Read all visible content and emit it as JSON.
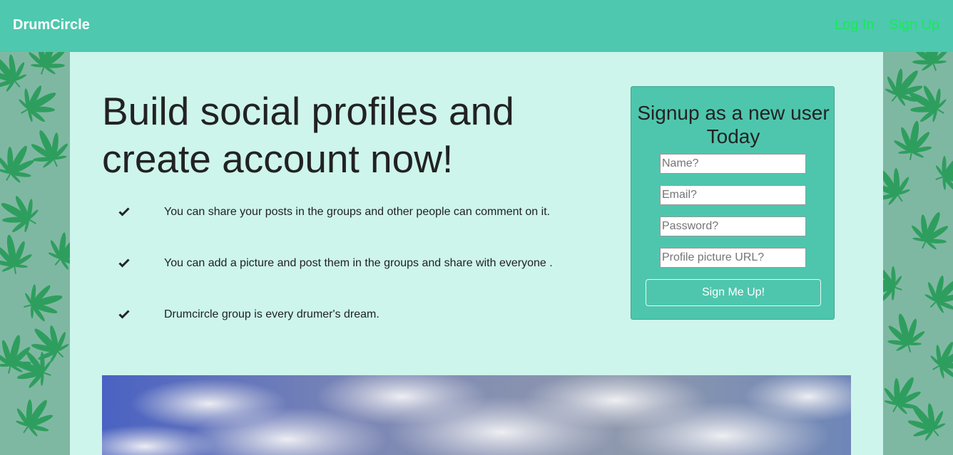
{
  "navbar": {
    "brand": "DrumCircle",
    "login_label": "Log In",
    "signup_label": "Sign Up",
    "bar_color": "#4ec8ae",
    "link_color": "#19e85c"
  },
  "hero": {
    "headline": "Build social profiles and create account now!",
    "features": [
      {
        "icon": "check-icon",
        "text": "You can share your posts in the groups and other people can comment on it."
      },
      {
        "icon": "check-icon",
        "text": "You can add a picture and post them in the groups and share with everyone ."
      },
      {
        "icon": "check-icon",
        "text": "Drumcircle group is every drumer's dream."
      }
    ]
  },
  "signup": {
    "title": "Signup as a new user Today",
    "name_placeholder": "Name?",
    "email_placeholder": "Email?",
    "password_placeholder": "Password?",
    "picture_placeholder": "Profile picture URL?",
    "button_label": "Sign Me Up!",
    "panel_color": "#4ec6ad"
  },
  "background": {
    "pattern_icon": "cannabis-leaf-icon",
    "side_color": "#7fb8a2",
    "main_color": "#cdf5ec"
  },
  "hero_image": {
    "icon": "cloudy-sky-image"
  }
}
